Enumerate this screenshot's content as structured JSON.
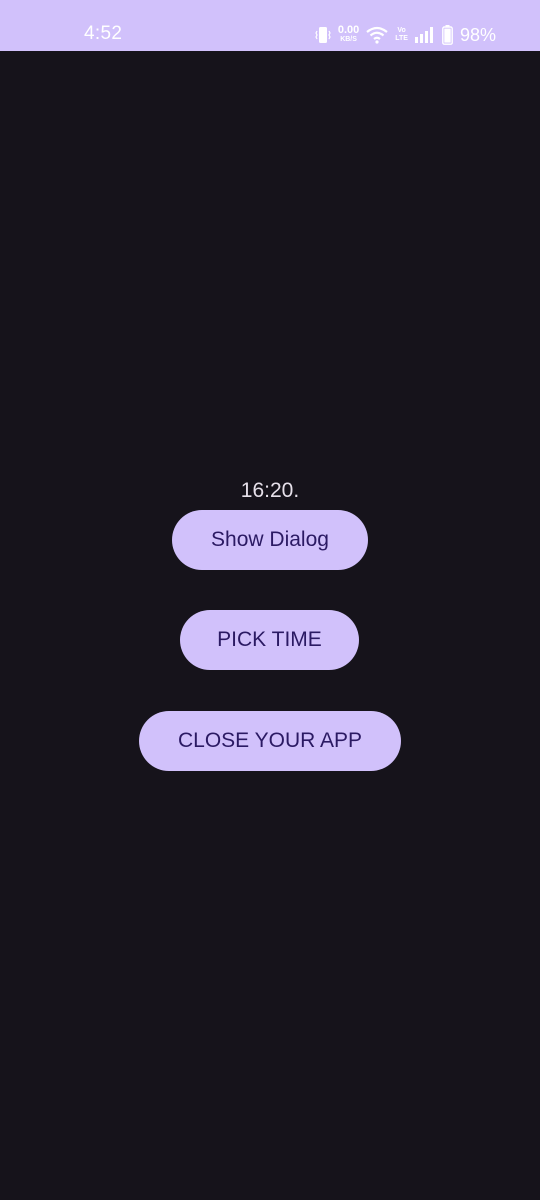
{
  "status_bar": {
    "time": "4:52",
    "net_speed_value": "0.00",
    "net_speed_unit": "KB/S",
    "volte_top": "Vo",
    "volte_bottom": "LTE",
    "battery_percent": "98%",
    "icons": [
      "vibrate-icon",
      "wifi-icon",
      "volte-icon",
      "signal-icon",
      "battery-icon"
    ]
  },
  "main": {
    "time_display": "16:20.",
    "buttons": {
      "show_dialog": "Show Dialog",
      "pick_time": "PICK TIME",
      "close_app": "CLOSE YOUR APP"
    }
  },
  "colors": {
    "status_bar_bg": "#d1c1fb",
    "background": "#16131b",
    "button_bg": "#d1c1fb",
    "button_text": "#2b1a63",
    "time_text": "#e6e0ea"
  }
}
